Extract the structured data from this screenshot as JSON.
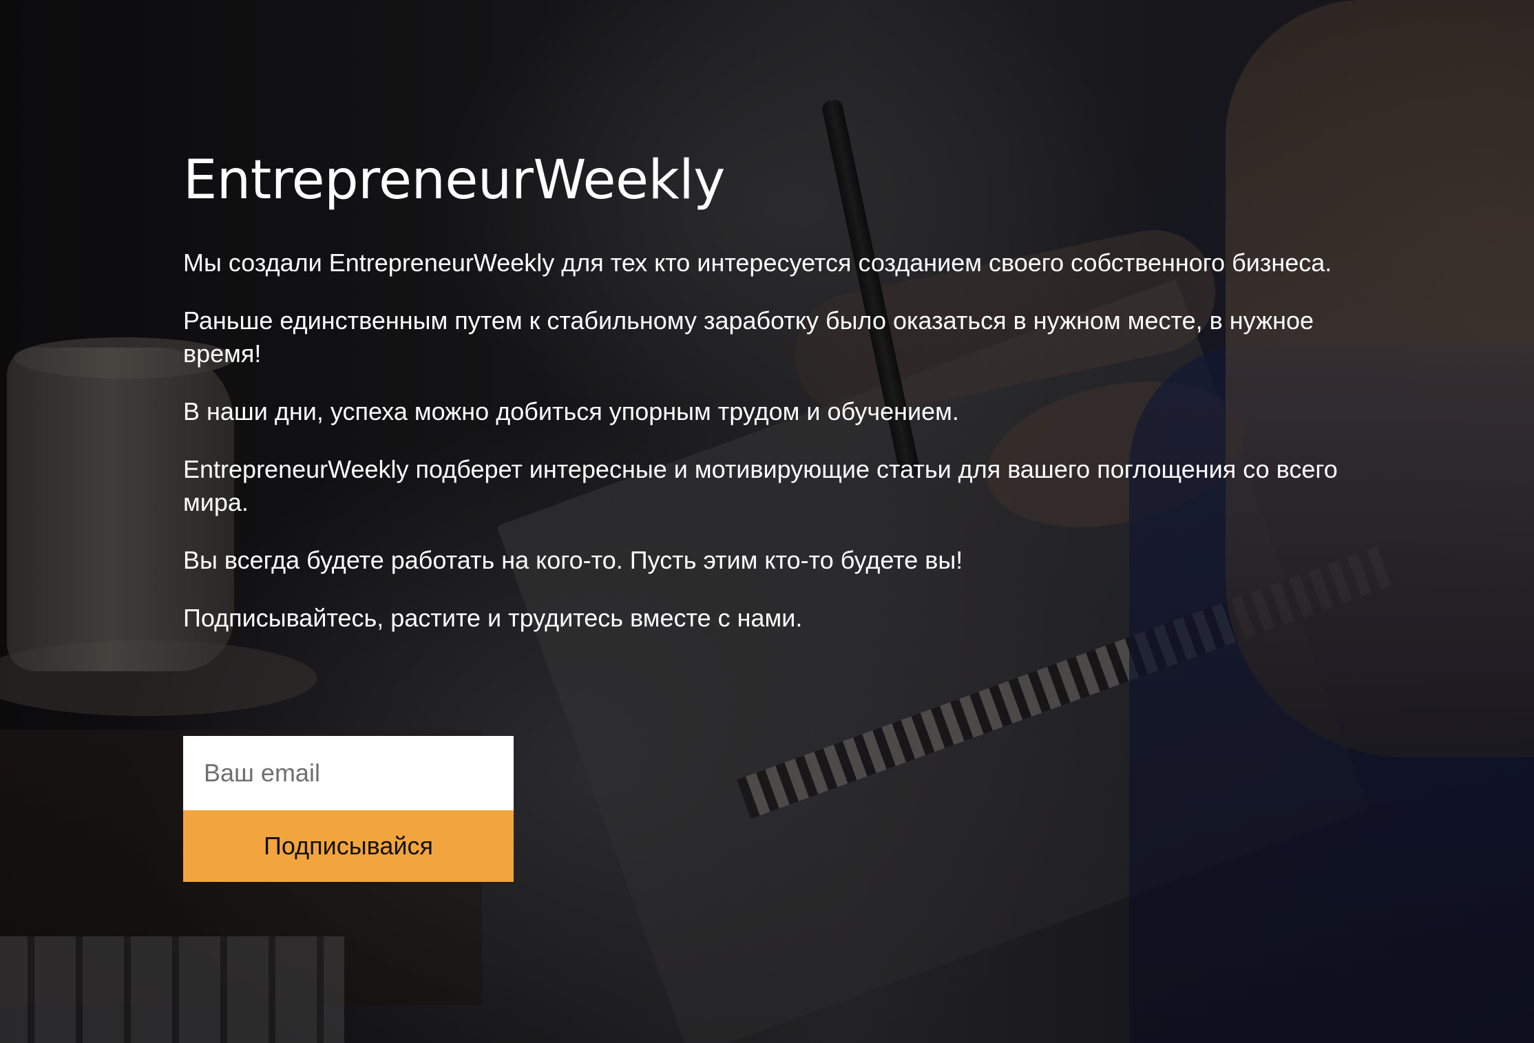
{
  "hero": {
    "title": "EntrepreneurWeekly",
    "paragraphs": [
      "Мы создали EntrepreneurWeekly для тех кто интересуется созданием своего собственного бизнеса.",
      "Раньше единственным путем к стабильному заработку было оказаться в нужном месте, в нужное время!",
      "В наши дни, успеха можно добиться упорным трудом и обучением.",
      "EntrepreneurWeekly подберет интересные и мотивирующие статьи для вашего поглощения со всего мира.",
      "Вы всегда будете работать на кого-то. Пусть этим кто-то будете вы!",
      "Подписывайтесь, растите и трудитесь вместе с нами."
    ]
  },
  "subscribe": {
    "email_value": "",
    "email_placeholder": "Ваш email",
    "button_label": "Подписывайся"
  },
  "colors": {
    "accent": "#f2a53c",
    "text": "#ffffff",
    "input_background": "#ffffff"
  }
}
